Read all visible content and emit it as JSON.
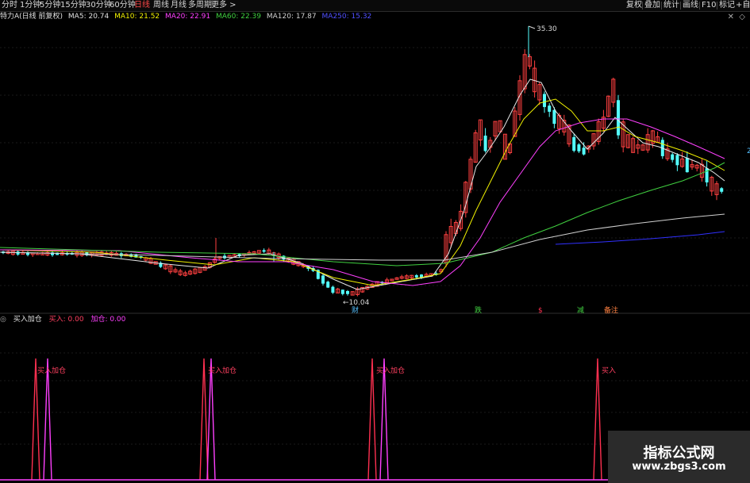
{
  "toolbar": {
    "periods": [
      "分时",
      "1分钟",
      "5分钟",
      "15分钟",
      "30分钟",
      "60分钟",
      "日线",
      "周线",
      "月线",
      "多周期",
      "更多 >"
    ],
    "active_period": "日线",
    "right_buttons": [
      "复权",
      "叠加",
      "统计",
      "画线",
      "F10",
      "标记",
      "+自"
    ]
  },
  "legend": {
    "stock": "特力A(日线 前复权)",
    "ma5": "MA5: 20.74",
    "ma10": "MA10: 21.52",
    "ma20": "MA20: 22.91",
    "ma60": "MA60: 22.39",
    "ma120": "MA120: 17.87",
    "ma250": "MA250: 15.32"
  },
  "colors": {
    "up": "#ff4040",
    "down": "#54ffff",
    "ma5": "#e8e8e8",
    "ma10": "#f0f000",
    "ma20": "#ff40ff",
    "ma60": "#40d040",
    "ma120": "#d0d0d0",
    "ma250": "#3030ff",
    "buy": "#ff3050",
    "add": "#ff40ff"
  },
  "price_labels": {
    "high": "35.30",
    "low": "10.04"
  },
  "events": [
    "财",
    "跌",
    "$",
    "减",
    "备注"
  ],
  "sub": {
    "title": "买入加仓",
    "buy": "买入: 0.00",
    "add": "加仓: 0.00",
    "signal_labels": [
      "买入加仓",
      "买入加仓",
      "买入加仓",
      "买入"
    ]
  },
  "edge_label": "2",
  "watermark": {
    "title": "指标公式网",
    "url": "www.zbgs3.com"
  },
  "chart_data": {
    "type": "candlestick",
    "price_range": [
      10.04,
      35.3
    ],
    "high": 35.3,
    "low": 10.04,
    "series": [
      {
        "name": "MA5",
        "value": 20.74
      },
      {
        "name": "MA10",
        "value": 21.52
      },
      {
        "name": "MA20",
        "value": 22.91
      },
      {
        "name": "MA60",
        "value": 22.39
      },
      {
        "name": "MA120",
        "value": 17.87
      },
      {
        "name": "MA250",
        "value": 15.32
      }
    ],
    "indicator": {
      "name": "买入加仓",
      "buy": 0.0,
      "add": 0.0
    }
  }
}
